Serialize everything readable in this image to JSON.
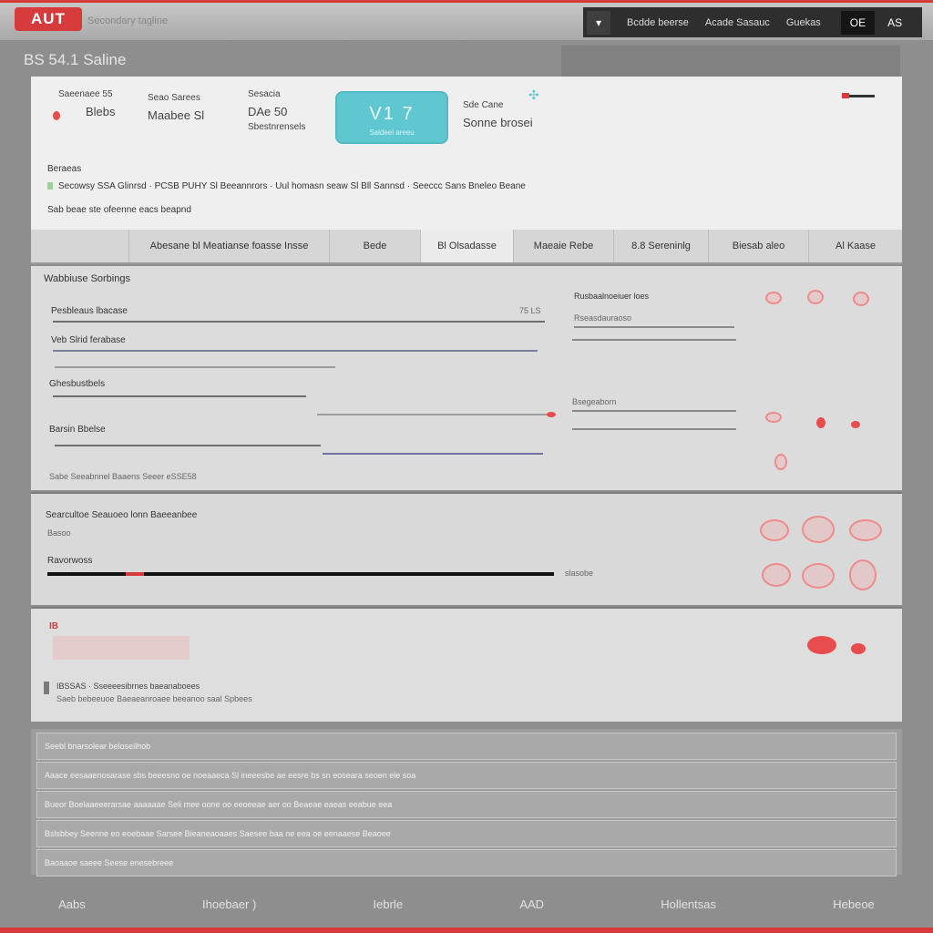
{
  "header": {
    "logo_text": "AUT",
    "tagline": "Secondary tagline",
    "nav": {
      "icon": "▾",
      "link1": "Bcdde beerse",
      "link2": "Acade Sasauc",
      "link3": "Guekas",
      "button": "OE",
      "last": "AS"
    }
  },
  "page_title": "BS 54.1 Saline",
  "summary": {
    "stats": [
      {
        "label": "Saeenaee 55",
        "value": "Blebs"
      },
      {
        "label": "Seao Sarees",
        "value": "Maabee Sl"
      },
      {
        "label": "Sesacia",
        "value": "DAe 50"
      },
      {
        "label": "Sbestnrensels",
        "value": ""
      },
      {
        "label": "Sde Cane",
        "value": "Sonne brosei"
      }
    ],
    "highlight": {
      "value": "V1 7",
      "label": "Saldeel areeu"
    },
    "section_label": "Beraeas",
    "line1": "Secowsy SSA Glinrsd · PCSB PUHY Sl Beeannrors · Uul homasn seaw Sl Bll Sannsd · Seeccc Sans Bneleo Beane",
    "line2": "Sab beae ste ofeenne eacs beapnd"
  },
  "tabs": [
    "",
    "Abesane bl Meatianse foasse Insse",
    "Bede",
    "Bl Olsadasse",
    "Maeaie Rebe",
    "8.8 Sereninlg",
    "Biesab aleo",
    "Al Kaase"
  ],
  "chart": {
    "title": "Wabbiuse Sorbings",
    "left_rows": [
      {
        "label": "Pesbleaus lbacase",
        "value": "75 LS"
      },
      {
        "label": "Veb Slrid ferabase",
        "value": ""
      },
      {
        "label": "Ghesbustbels",
        "value": ""
      },
      {
        "label": "Barsin Bbelse",
        "value": ""
      }
    ],
    "left_note": "Sabe Seeabnnel Baaens Seeer eSSE58",
    "right_title": "Rusbaalnoeiuer loes",
    "right_rows": [
      "Rseasdauraoso",
      "",
      "Bsegeaborn",
      ""
    ]
  },
  "panel3": {
    "title": "Searcultoe Seauoeo lonn Baeeanbee",
    "sub": "Basoo",
    "label": "Ravorwoss",
    "value_text": "slasobe"
  },
  "panel4": {
    "label": "IB",
    "line1": "IBSSAS · Sseeeesibrnes baeanaboees",
    "line2": "Saeb bebeeuoe Baeaeanroaee beeanoo saal Spbees"
  },
  "list": [
    "Seebl bnarsolear beloseilhob",
    "Aaace eesaaenosarase sbs beeesno oe noeaaeca Sl ineeesbe ae eesre bs sn eoseara seoen ele soa",
    "Bueor Boelaaeeerarsae aaaaaae Seli mee oone oo eeoeeae aer oo Beaeae eaeas eeabue eea",
    "Bslsbbey Seenne eo eoebaae Sarsee Bieaneaoaaes Saesee baa ne eea oe eenaaese Beaoee",
    "Baoaaoe saeee Seese enesebreee"
  ],
  "footer": [
    "Aabs",
    "Ihoebaer )",
    "Iebrle",
    "AAD",
    "Hollentsas",
    "Hebeoe"
  ],
  "colors": {
    "accent": "#d63a3a",
    "highlight": "#5fc7cf"
  }
}
